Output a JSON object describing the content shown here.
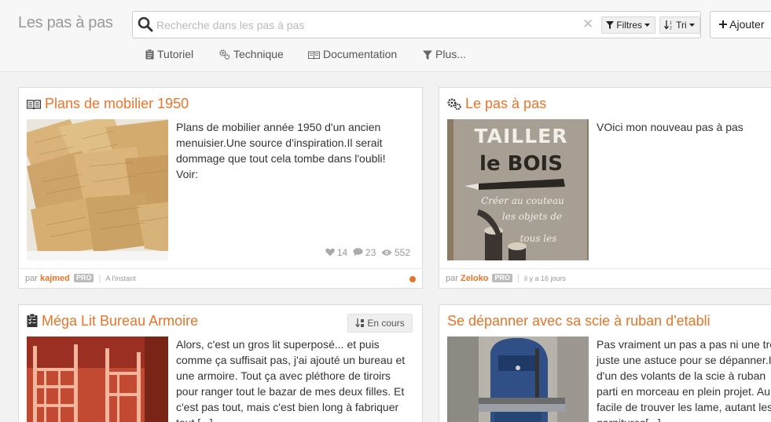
{
  "header": {
    "brand": "Les pas à pas",
    "search_placeholder": "Recherche dans les pas à pas",
    "clear_glyph": "✕",
    "filters_label": "Filtres",
    "sort_label": "Tri",
    "add_label": "Ajouter"
  },
  "nav": [
    {
      "label": "Tutoriel",
      "icon": "clipboard-icon"
    },
    {
      "label": "Technique",
      "icon": "cogs-icon"
    },
    {
      "label": "Documentation",
      "icon": "book-icon"
    },
    {
      "label": "Plus...",
      "icon": "filter-icon"
    }
  ],
  "cards": [
    {
      "title": "Plans de mobilier 1950",
      "icon": "book-icon",
      "description": [
        "Plans de mobilier année 1950 d'un ancien",
        "menuisier.Une source d'inspiration.Il serait",
        "dommage que tout cela tombe dans l'oubli!",
        "Voir:"
      ],
      "likes": "14",
      "comments": "23",
      "views": "552",
      "author_prefix": "par",
      "author": "kajmed",
      "pro": "PRO",
      "time": "A l'instant"
    },
    {
      "title": "Le pas à pas",
      "icon": "cogs-icon",
      "description": [
        "VOici mon nouveau pas à pas"
      ],
      "thumb_text": [
        "TAILLER",
        "le BOIS",
        "Créer au couteau",
        "les objets de",
        "tous les"
      ],
      "author_prefix": "par",
      "author": "Zeloko",
      "pro": "PRO",
      "time": "il y a 16 jours"
    },
    {
      "title": "Méga Lit Bureau Armoire",
      "icon": "clipboard-check-icon",
      "badge": "En cours",
      "description": [
        "Alors, c'est un gros lit superposé... et puis",
        "comme ça suffisait pas, j'ai ajouté un bureau et",
        "une armoire. Tout ça avec pléthore de tiroirs",
        "pour ranger tout le bazar de mes deux filles. Et",
        "c'est pas tout, mais c'est bien long à fabriquer",
        "tout [...]"
      ]
    },
    {
      "title": "Se dépanner avec sa scie à ruban d'etabli",
      "description": [
        "Pas vraiment un pas a pas ni une tre",
        "juste une astuce pour se dépanner.I",
        "d'un des volants de la scie à ruban",
        "parti en morceau en plein projet. Au",
        "facile de trouver les lame, autant les",
        "garnitures[...]"
      ]
    }
  ],
  "colors": {
    "accent": "#e8752a",
    "background": "#f2f2f2"
  }
}
